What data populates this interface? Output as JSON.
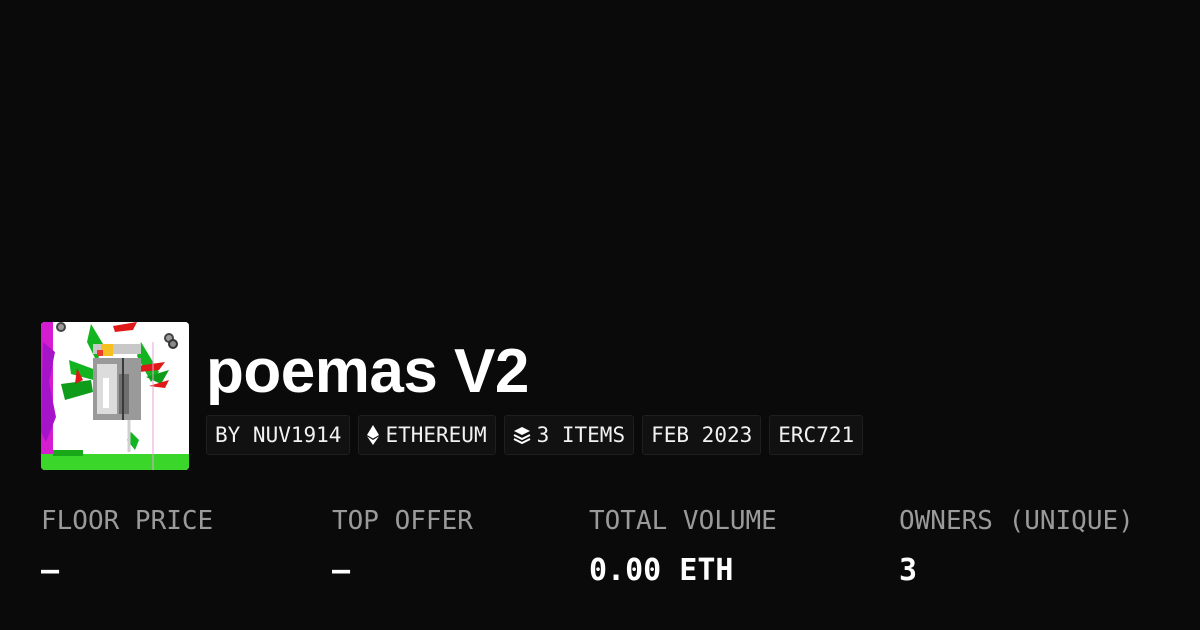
{
  "collection": {
    "name": "poemas V2",
    "tags": {
      "creator": "BY NUV1914",
      "chain": "ETHEREUM",
      "items": "3 ITEMS",
      "date": "FEB 2023",
      "standard": "ERC721"
    },
    "icons": {
      "chain": "ethereum-icon",
      "items": "layers-icon"
    }
  },
  "stats": {
    "floor_price": {
      "label": "FLOOR PRICE",
      "value": "—"
    },
    "top_offer": {
      "label": "TOP OFFER",
      "value": "—"
    },
    "total_volume": {
      "label": "TOTAL VOLUME",
      "value": "0.00 ETH"
    },
    "owners": {
      "label": "OWNERS (UNIQUE)",
      "value": "3"
    }
  },
  "colors": {
    "background": "#0a0a0a",
    "text": "#ffffff",
    "muted": "#9a9a9a",
    "tag_bg": "#111111"
  }
}
